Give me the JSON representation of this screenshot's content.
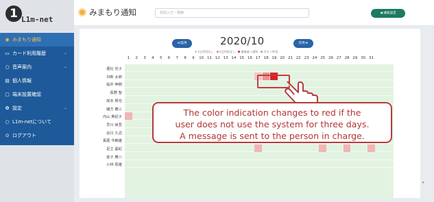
{
  "app": {
    "logo_number": "1",
    "logo_text": "L1m-net"
  },
  "sidebar": {
    "items": [
      {
        "label": "みまもり通知",
        "icon": "eye-icon",
        "active": true
      },
      {
        "label": "カード利用履歴",
        "icon": "card-icon",
        "caret": "⌄"
      },
      {
        "label": "音声案内",
        "icon": "circle-icon",
        "caret": "⌄"
      },
      {
        "label": "個人情報",
        "icon": "document-icon"
      },
      {
        "label": "端末設置確認",
        "icon": "file-icon"
      },
      {
        "label": "設定",
        "icon": "gear-icon",
        "caret": "⌄"
      },
      {
        "label": "L1m-netについて",
        "icon": "info-circle-icon"
      },
      {
        "label": "ログアウト",
        "icon": "logout-icon"
      }
    ]
  },
  "header": {
    "title": "みまもり通知",
    "search_placeholder": "名前入力・検索",
    "settings_button": "◀ 通知設定"
  },
  "calendar": {
    "month": "2020/10",
    "prev_label": "≪前月",
    "next_label": "次月≫",
    "legend": [
      {
        "label": "1日利用なし",
        "color": "#f6b6b6"
      },
      {
        "label": "2日利用なし",
        "color": "#e97f7f"
      },
      {
        "label": "事業者へ通知",
        "color": "#d92525"
      },
      {
        "label": "ボタン利用",
        "color": "#9e9e9e"
      }
    ],
    "days": [
      1,
      2,
      3,
      4,
      5,
      6,
      7,
      8,
      9,
      10,
      11,
      12,
      13,
      14,
      15,
      16,
      17,
      18,
      19,
      20,
      21,
      22,
      23,
      24,
      25,
      26,
      27,
      28,
      29,
      30,
      31
    ],
    "names": [
      "堀社 花子",
      "日新 太郎",
      "桜井 伸樹",
      "長野 智",
      "岸本 照也",
      "緒方 義三",
      "内山 貴紀子",
      "早川 良吾",
      "谷口 久迅",
      "長尾 今朝雄",
      "足立 晶紀",
      "金子 廣八",
      "小林 辰雄"
    ],
    "cells": [
      {
        "row": 1,
        "day": 17,
        "level": "1日利用なし",
        "color": "#f6c6c6"
      },
      {
        "row": 1,
        "day": 18,
        "level": "2日利用なし",
        "color": "#ef8f8f"
      },
      {
        "row": 1,
        "day": 19,
        "level": "事業者へ通知",
        "color": "#dd2222"
      },
      {
        "row": 6,
        "day": 1,
        "level": "1日利用なし",
        "color": "#f2b4b4"
      },
      {
        "row": 10,
        "day": 17,
        "level": "1日利用なし",
        "color": "#f2b4b4"
      },
      {
        "row": 10,
        "day": 25,
        "level": "1日利用なし",
        "color": "#f2b4b4"
      },
      {
        "row": 10,
        "day": 28,
        "level": "1日利用なし",
        "color": "#f2b4b4"
      },
      {
        "row": 10,
        "day": 31,
        "level": "1日利用なし",
        "color": "#f2b4b4"
      }
    ]
  },
  "callout": {
    "lines": [
      "The color indication changes to red if the",
      "user does not use the system for three days.",
      "A message is sent to the person in charge."
    ]
  },
  "colors": {
    "nav_bg": "#1e5a99",
    "accent_green": "#1d7a63",
    "month_button": "#2a64a8",
    "grid_bg": "#e3f3e1",
    "callout_red": "#b33535"
  }
}
